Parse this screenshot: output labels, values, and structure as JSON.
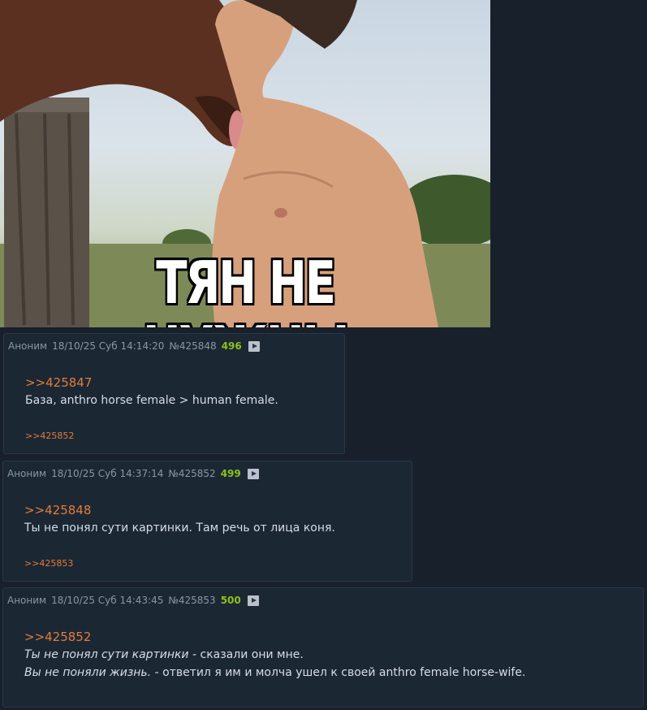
{
  "meme": {
    "caption": "ТЯН НЕ НУЖНЫ"
  },
  "posts": [
    {
      "author": "Аноним",
      "datetime": "18/10/25 Суб 14:14:20",
      "number": "№425848",
      "count": "496",
      "reply_to": ">>425847",
      "text": "База, anthro horse female > human female.",
      "backlink": ">>425852"
    },
    {
      "author": "Аноним",
      "datetime": "18/10/25 Суб 14:37:14",
      "number": "№425852",
      "count": "499",
      "reply_to": ">>425848",
      "text": "Ты не понял сути картинки. Там речь от лица коня.",
      "backlink": ">>425853"
    },
    {
      "author": "Аноним",
      "datetime": "18/10/25 Суб 14:43:45",
      "number": "№425853",
      "count": "500",
      "reply_to": ">>425852",
      "line1_italic": "Ты не понял сути картинки",
      "line1_rest": " - сказали они мне.",
      "line2_italic": "Вы не поняли жизнь.",
      "line2_rest": " - ответил я им и молча ушел к своей anthro female horse-wife."
    }
  ],
  "colors": {
    "background": "#17202b",
    "post": "#1c2734",
    "link": "#e17d39",
    "count": "#8fc11b"
  }
}
